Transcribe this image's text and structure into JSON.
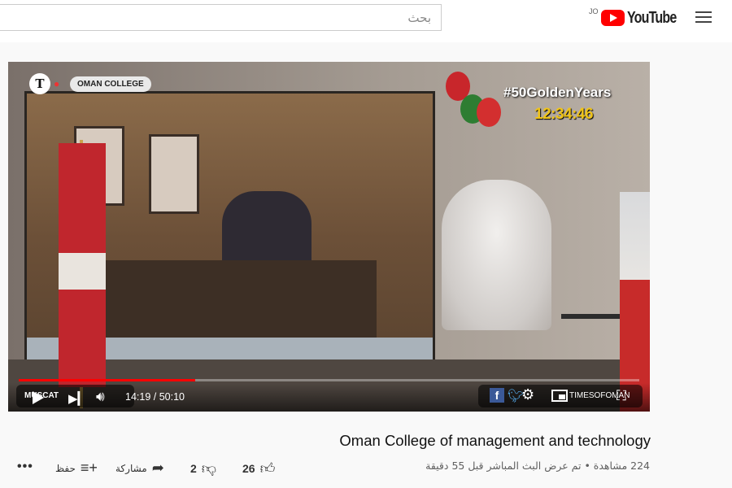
{
  "header": {
    "search_placeholder": "بحث",
    "country_code": "JO",
    "logo_text": "YouTube"
  },
  "player": {
    "channel_tag": "OMAN COLLEGE",
    "hashtag": "#50GoldenYears",
    "overlay_clock": "12:34:46",
    "overlay_location": "MUSCAT",
    "current_time": "14:19",
    "duration": "50:10",
    "time_separator": " / ",
    "progress_fraction": 0.285,
    "social_handle": "TIMESOFOMAN",
    "colors": {
      "progress": "#ff0000",
      "hashtag": "#ffffff",
      "clock": "#f0c419"
    }
  },
  "video": {
    "title": "Oman College of management and technology",
    "stats": "224 مشاهدة • تم عرض البث المباشر قبل 55 دقيقة",
    "likes": "26",
    "dislikes": "2",
    "share_label": "مشاركة",
    "save_label": "حفظ"
  },
  "icons": [
    "menu-icon",
    "play-icon",
    "next-icon",
    "volume-icon",
    "settings-icon",
    "miniplayer-icon",
    "fullscreen-icon",
    "like-icon",
    "dislike-icon",
    "share-icon",
    "save-icon",
    "more-icon"
  ]
}
